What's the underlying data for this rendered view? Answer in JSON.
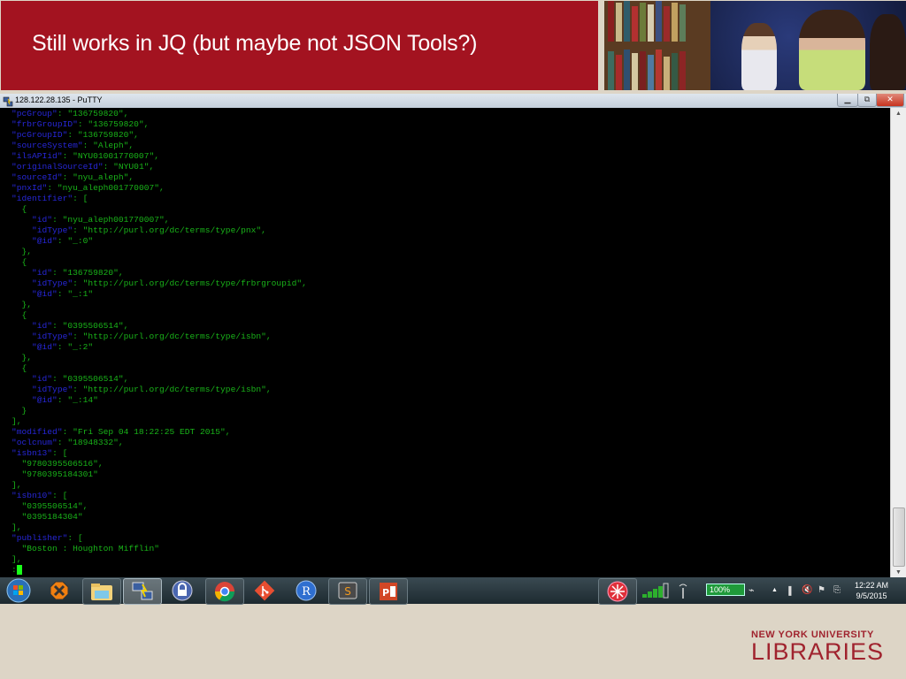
{
  "slide": {
    "title": "Still works in JQ (but maybe not JSON Tools?)",
    "logo_line1": "NEW YORK UNIVERSITY",
    "logo_line2": "LIBRARIES"
  },
  "colors": {
    "banner": "#a31320",
    "json_key": "#2727d8",
    "json_value": "#19b319",
    "terminal_bg": "#000000"
  },
  "window": {
    "title": "128.122.28.135 - PuTTY",
    "minimize_icon": "minimize-icon",
    "maximize_icon": "restore-icon",
    "close_icon": "close-icon"
  },
  "terminal": {
    "lines": [
      [
        [
          "k",
          "\"pcGroup\""
        ],
        [
          "v",
          ": \"136759820\","
        ]
      ],
      [
        [
          "k",
          "\"frbrGroupID\""
        ],
        [
          "v",
          ": \"136759820\","
        ]
      ],
      [
        [
          "k",
          "\"pcGroupID\""
        ],
        [
          "v",
          ": \"136759820\","
        ]
      ],
      [
        [
          "k",
          "\"sourceSystem\""
        ],
        [
          "v",
          ": \"Aleph\","
        ]
      ],
      [
        [
          "k",
          "\"ilsAPIid\""
        ],
        [
          "v",
          ": \"NYU01001770007\","
        ]
      ],
      [
        [
          "k",
          "\"originalSourceId\""
        ],
        [
          "v",
          ": \"NYU01\","
        ]
      ],
      [
        [
          "k",
          "\"sourceId\""
        ],
        [
          "v",
          ": \"nyu_aleph\","
        ]
      ],
      [
        [
          "k",
          "\"pnxId\""
        ],
        [
          "v",
          ": \"nyu_aleph001770007\","
        ]
      ],
      [
        [
          "k",
          "\"identifier\""
        ],
        [
          "v",
          ": ["
        ]
      ],
      [
        [
          "v",
          "  {"
        ]
      ],
      [
        [
          "v",
          "    "
        ],
        [
          "k",
          "\"id\""
        ],
        [
          "v",
          ": \"nyu_aleph001770007\","
        ]
      ],
      [
        [
          "v",
          "    "
        ],
        [
          "k",
          "\"idType\""
        ],
        [
          "v",
          ": \"http://purl.org/dc/terms/type/pnx\","
        ]
      ],
      [
        [
          "v",
          "    "
        ],
        [
          "k",
          "\"@id\""
        ],
        [
          "v",
          ": \"_:0\""
        ]
      ],
      [
        [
          "v",
          "  },"
        ]
      ],
      [
        [
          "v",
          "  {"
        ]
      ],
      [
        [
          "v",
          "    "
        ],
        [
          "k",
          "\"id\""
        ],
        [
          "v",
          ": \"136759820\","
        ]
      ],
      [
        [
          "v",
          "    "
        ],
        [
          "k",
          "\"idType\""
        ],
        [
          "v",
          ": \"http://purl.org/dc/terms/type/frbrgroupid\","
        ]
      ],
      [
        [
          "v",
          "    "
        ],
        [
          "k",
          "\"@id\""
        ],
        [
          "v",
          ": \"_:1\""
        ]
      ],
      [
        [
          "v",
          "  },"
        ]
      ],
      [
        [
          "v",
          "  {"
        ]
      ],
      [
        [
          "v",
          "    "
        ],
        [
          "k",
          "\"id\""
        ],
        [
          "v",
          ": \"0395506514\","
        ]
      ],
      [
        [
          "v",
          "    "
        ],
        [
          "k",
          "\"idType\""
        ],
        [
          "v",
          ": \"http://purl.org/dc/terms/type/isbn\","
        ]
      ],
      [
        [
          "v",
          "    "
        ],
        [
          "k",
          "\"@id\""
        ],
        [
          "v",
          ": \"_:2\""
        ]
      ],
      [
        [
          "v",
          "  },"
        ]
      ],
      [
        [
          "v",
          "  {"
        ]
      ],
      [
        [
          "v",
          "    "
        ],
        [
          "k",
          "\"id\""
        ],
        [
          "v",
          ": \"0395506514\","
        ]
      ],
      [
        [
          "v",
          "    "
        ],
        [
          "k",
          "\"idType\""
        ],
        [
          "v",
          ": \"http://purl.org/dc/terms/type/isbn\","
        ]
      ],
      [
        [
          "v",
          "    "
        ],
        [
          "k",
          "\"@id\""
        ],
        [
          "v",
          ": \"_:14\""
        ]
      ],
      [
        [
          "v",
          "  }"
        ]
      ],
      [
        [
          "v",
          "],"
        ]
      ],
      [
        [
          "k",
          "\"modified\""
        ],
        [
          "v",
          ": \"Fri Sep 04 18:22:25 EDT 2015\","
        ]
      ],
      [
        [
          "k",
          "\"oclcnum\""
        ],
        [
          "v",
          ": \"18948332\","
        ]
      ],
      [
        [
          "k",
          "\"isbn13\""
        ],
        [
          "v",
          ": ["
        ]
      ],
      [
        [
          "v",
          "  \"9780395506516\","
        ]
      ],
      [
        [
          "v",
          "  \"9780395184301\""
        ]
      ],
      [
        [
          "v",
          "],"
        ]
      ],
      [
        [
          "k",
          "\"isbn10\""
        ],
        [
          "v",
          ": ["
        ]
      ],
      [
        [
          "v",
          "  \"0395506514\","
        ]
      ],
      [
        [
          "v",
          "  \"0395184304\""
        ]
      ],
      [
        [
          "v",
          "],"
        ]
      ],
      [
        [
          "k",
          "\"publisher\""
        ],
        [
          "v",
          ": ["
        ]
      ],
      [
        [
          "v",
          "  \"Boston : Houghton Mifflin\""
        ]
      ],
      [
        [
          "v",
          "],"
        ]
      ]
    ],
    "prompt": ":"
  },
  "taskbar": {
    "items": [
      {
        "name": "start-button",
        "icon": "windows-start-icon"
      },
      {
        "name": "taskbar-app-xmarks",
        "icon": "orange-x-icon"
      },
      {
        "name": "taskbar-app-explorer",
        "icon": "folder-icon"
      },
      {
        "name": "taskbar-app-putty",
        "icon": "putty-icon"
      },
      {
        "name": "taskbar-app-keepass",
        "icon": "lock-icon"
      },
      {
        "name": "taskbar-app-chrome",
        "icon": "chrome-icon"
      },
      {
        "name": "taskbar-app-git",
        "icon": "git-icon"
      },
      {
        "name": "taskbar-app-r",
        "icon": "r-icon"
      },
      {
        "name": "taskbar-app-sublime",
        "icon": "sublime-icon"
      },
      {
        "name": "taskbar-app-powerpoint",
        "icon": "powerpoint-icon"
      }
    ],
    "tray": {
      "battery_percent": "100%",
      "time": "12:22 AM",
      "date": "9/5/2015"
    }
  }
}
